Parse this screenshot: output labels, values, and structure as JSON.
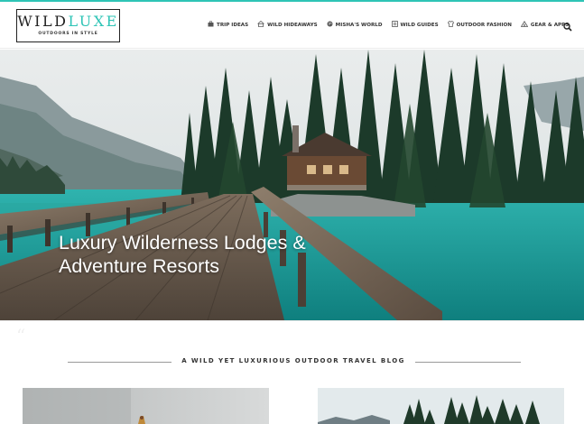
{
  "brand": {
    "word_primary": "WILD",
    "word_accent": "LUXE",
    "tagline": "OUTDOORS IN STYLE",
    "accent_color": "#2ec4b6"
  },
  "nav": {
    "items": [
      {
        "label": "TRIP IDEAS",
        "icon": "briefcase-icon"
      },
      {
        "label": "WILD HIDEAWAYS",
        "icon": "house-icon"
      },
      {
        "label": "MISHA'S WORLD",
        "icon": "globe-icon"
      },
      {
        "label": "WILD GUIDES",
        "icon": "guide-icon"
      },
      {
        "label": "OUTDOOR FASHION",
        "icon": "shirt-icon"
      },
      {
        "label": "GEAR & APPS",
        "icon": "tent-icon"
      }
    ],
    "search_icon": "search-icon"
  },
  "hero": {
    "title_line1": "Luxury Wilderness Lodges &",
    "title_line2": "Adventure Resorts"
  },
  "section": {
    "tagline": "A WILD YET LUXURIOUS OUTDOOR TRAVEL BLOG"
  }
}
